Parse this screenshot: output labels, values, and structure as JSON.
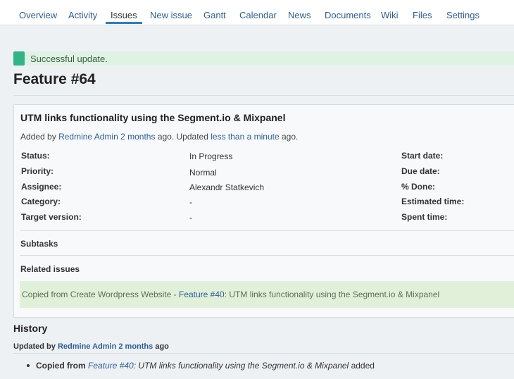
{
  "tabs": [
    {
      "label": "Overview",
      "active": false
    },
    {
      "label": "Activity",
      "active": false
    },
    {
      "label": "Issues",
      "active": true
    },
    {
      "label": "New issue",
      "active": false
    },
    {
      "label": "Gantt",
      "active": false
    },
    {
      "label": "Calendar",
      "active": false
    },
    {
      "label": "News",
      "active": false
    },
    {
      "label": "Documents",
      "active": false
    },
    {
      "label": "Wiki",
      "active": false
    },
    {
      "label": "Files",
      "active": false
    },
    {
      "label": "Settings",
      "active": false
    }
  ],
  "flash": {
    "message": "Successful update."
  },
  "issue": {
    "title": "Feature #64",
    "subject": "UTM links functionality using the Segment.io & Mixpanel",
    "author_line": {
      "added_by": "Added by",
      "author": "Redmine Admin",
      "created": "2 months",
      "ago_updated": "ago. Updated",
      "updated": "less than a minute",
      "ago": "ago."
    },
    "attributes_left": [
      {
        "label": "Status:",
        "value": "In Progress",
        "link": false
      },
      {
        "label": "Priority:",
        "value": "Normal",
        "link": false
      },
      {
        "label": "Assignee:",
        "value": "Alexandr Statkevich",
        "link": true
      },
      {
        "label": "Category:",
        "value": "-",
        "link": false
      },
      {
        "label": "Target version:",
        "value": "-",
        "link": false
      }
    ],
    "attributes_right": [
      {
        "label": "Start date:"
      },
      {
        "label": "Due date:"
      },
      {
        "label": "% Done:"
      },
      {
        "label": "Estimated time:"
      },
      {
        "label": "Spent time:"
      }
    ],
    "subtasks_title": "Subtasks",
    "related_title": "Related issues",
    "relation": {
      "prefix": "Copied from Create Wordpress Website - ",
      "link": "Feature #40",
      "suffix": ": UTM links functionality using the Segment.io & Mixpanel"
    }
  },
  "colors": {
    "link": "#2a5f9b",
    "flash_icon": "#2fb586",
    "flash_bg": "#dff3e4",
    "relation_bg": "#e1f0d8",
    "active_tab_underline": "#2a7fc1"
  },
  "history": {
    "title": "History",
    "journal_head": {
      "updated_by": "Updated by",
      "author": "Redmine Admin",
      "when": "2 months",
      "ago": "ago"
    },
    "item": {
      "prefix": "Copied from",
      "link": "Feature #40",
      "title": ": UTM links functionality using the Segment.io & Mixpanel",
      "suffix": "added"
    }
  }
}
